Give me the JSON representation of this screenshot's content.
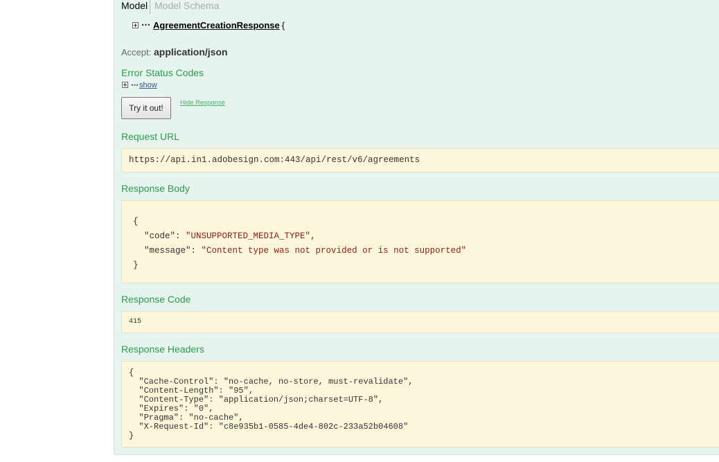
{
  "model_tabs": {
    "model": "Model",
    "schema": "Model Schema"
  },
  "model": {
    "name": "AgreementCreationResponse",
    "brace": "{"
  },
  "accept": {
    "label": "Accept:",
    "value": "application/json"
  },
  "error_status": {
    "title": "Error Status Codes",
    "link": "show"
  },
  "buttons": {
    "try": "Try it out!",
    "hide": "Hide Response"
  },
  "request_url": {
    "title": "Request URL",
    "value": "https://api.in1.adobesign.com:443/api/rest/v6/agreements"
  },
  "response_body": {
    "title": "Response Body",
    "open": "{",
    "code_key": "\"code\"",
    "code_val": "\"UNSUPPORTED_MEDIA_TYPE\"",
    "message_key": "\"message\"",
    "message_val": "\"Content type was not provided or is not supported\"",
    "close": "}"
  },
  "response_code": {
    "title": "Response Code",
    "value": "415"
  },
  "response_headers": {
    "title": "Response Headers",
    "text": "{\n  \"Cache-Control\": \"no-cache, no-store, must-revalidate\",\n  \"Content-Length\": \"95\",\n  \"Content-Type\": \"application/json;charset=UTF-8\",\n  \"Expires\": \"0\",\n  \"Pragma\": \"no-cache\",\n  \"X-Request-Id\": \"c8e935b1-0585-4de4-802c-233a52b04608\"\n}"
  },
  "colors": {
    "panel_bg": "#e7f4ed",
    "section_title": "#2b9a4d",
    "code_bg": "#fcf6db",
    "link": "#2f56a3"
  }
}
